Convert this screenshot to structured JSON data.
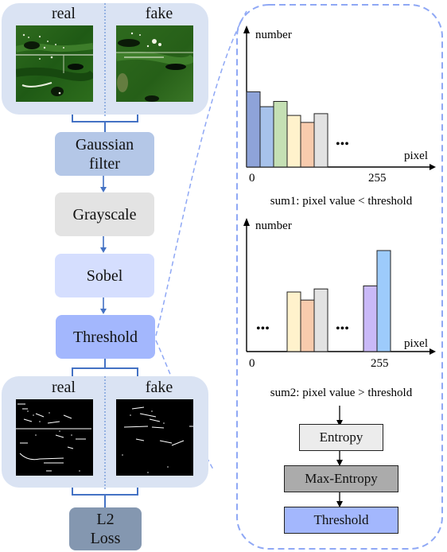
{
  "left_pipeline": {
    "input_panel": {
      "real_label": "real",
      "fake_label": "fake"
    },
    "steps": [
      {
        "label": "Gaussian filter",
        "line1": "Gaussian",
        "line2": "filter",
        "color": "#b4c7e7"
      },
      {
        "label": "Grayscale",
        "color": "#e3e3e3"
      },
      {
        "label": "Sobel",
        "color": "#d5defe"
      },
      {
        "label": "Threshold",
        "color": "#a3b7fd"
      }
    ],
    "output_panel": {
      "real_label": "real",
      "fake_label": "fake"
    },
    "loss": {
      "line1": "L2",
      "line2": "Loss",
      "color": "#8497b0"
    }
  },
  "right_panel": {
    "histogram1": {
      "ylabel": "number",
      "xlabel": "pixel",
      "x_start": "0",
      "x_end": "255",
      "ellipsis": "•••",
      "caption": "sum1: pixel value < threshold"
    },
    "histogram2": {
      "ylabel": "number",
      "xlabel": "pixel",
      "x_start": "0",
      "x_end": "255",
      "ellipsis": "•••",
      "caption": "sum2: pixel value > threshold"
    },
    "flow": [
      {
        "label": "Entropy",
        "color": "#ececec"
      },
      {
        "label": "Max-Entropy",
        "color": "#ababab"
      },
      {
        "label": "Threshold",
        "color": "#a3b7fd"
      }
    ]
  },
  "chart_data": [
    {
      "type": "bar",
      "title": "sum1: pixel value < threshold",
      "xlabel": "pixel",
      "ylabel": "number",
      "x_ticks": [
        "0",
        "255"
      ],
      "bars": [
        {
          "value": 0.86,
          "color": "#8ea3d9"
        },
        {
          "value": 0.69,
          "color": "#a7c2eb"
        },
        {
          "value": 0.75,
          "color": "#c5e0b4"
        },
        {
          "value": 0.59,
          "color": "#fff2cc"
        },
        {
          "value": 0.51,
          "color": "#f8cbad"
        },
        {
          "value": 0.61,
          "color": "#e2e2e2"
        }
      ]
    },
    {
      "type": "bar",
      "title": "sum2: pixel value > threshold",
      "xlabel": "pixel",
      "ylabel": "number",
      "x_ticks": [
        "0",
        "255"
      ],
      "bars": [
        {
          "value": 0.59,
          "color": "#fff2cc"
        },
        {
          "value": 0.51,
          "color": "#f8cbad"
        },
        {
          "value": 0.62,
          "color": "#e2e2e2"
        },
        {
          "value": 0.65,
          "color": "#c9b9f7"
        },
        {
          "value": 1.0,
          "color": "#9dcbfb"
        }
      ]
    }
  ]
}
